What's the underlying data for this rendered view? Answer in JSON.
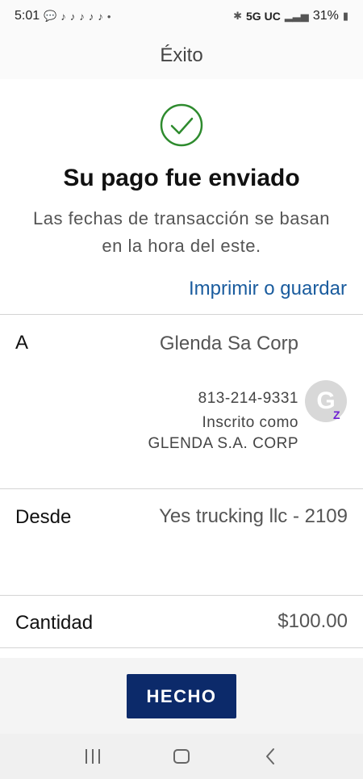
{
  "status_bar": {
    "time": "5:01",
    "network": "5G UC",
    "battery": "31%"
  },
  "header": {
    "title": "Éxito"
  },
  "success": {
    "title": "Su pago fue enviado",
    "subtitle": "Las fechas de transacción se basan en la hora del este.",
    "print_link": "Imprimir o guardar",
    "check_color": "#2e8b2e"
  },
  "recipient": {
    "label": "A",
    "name": "Glenda Sa Corp",
    "phone": "813-214-9331",
    "enrolled": "Inscrito como GLENDA S.A. CORP",
    "avatar_initial": "G",
    "badge": "Z"
  },
  "sender": {
    "label": "Desde",
    "account": "Yes trucking llc - 2109"
  },
  "amount": {
    "label": "Cantidad",
    "value": "$100.00"
  },
  "actions": {
    "done_label": "HECHO"
  },
  "colors": {
    "accent_link": "#1a5c9e",
    "primary_button": "#0c2a6a",
    "zelle_purple": "#6d1ed4"
  },
  "icons": [
    "chat-icon",
    "tiktok-icon",
    "bluetooth-icon",
    "signal-icon",
    "battery-icon",
    "check-circle-icon",
    "recents-icon",
    "home-icon",
    "back-icon"
  ]
}
